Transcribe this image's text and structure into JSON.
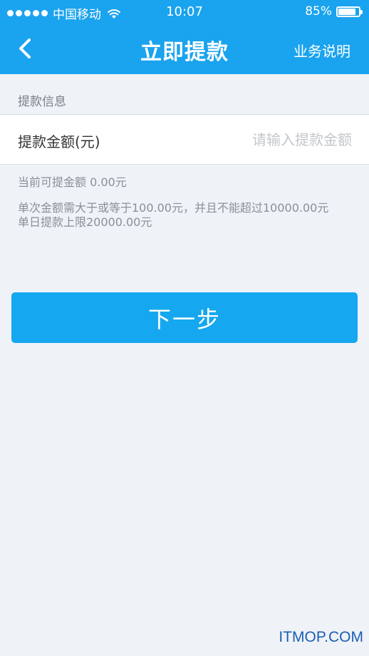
{
  "status_bar": {
    "carrier": "中国移动",
    "time": "10:07",
    "battery": "85%",
    "battery_level": 0.85,
    "icons": [
      "signal-dots-icon",
      "wifi-icon",
      "battery-icon"
    ]
  },
  "nav": {
    "back_icon": "chevron-left-icon",
    "title": "立即提款",
    "help_label": "业务说明"
  },
  "form": {
    "section_title": "提款信息",
    "amount_label": "提款金额(元)",
    "amount_value": "",
    "amount_placeholder": "请输入提款金额"
  },
  "hints": {
    "available": "当前可提金额 0.00元",
    "single_limit": "单次金额需大于或等于100.00元，并且不能超过10000.00元",
    "daily_limit": "单日提款上限20000.00元"
  },
  "actions": {
    "next_label": "下一步"
  },
  "watermark": "ITMOP.COM",
  "colors": {
    "header": "#1aa3ee",
    "button": "#15a7ef",
    "background": "#eff2f7"
  }
}
